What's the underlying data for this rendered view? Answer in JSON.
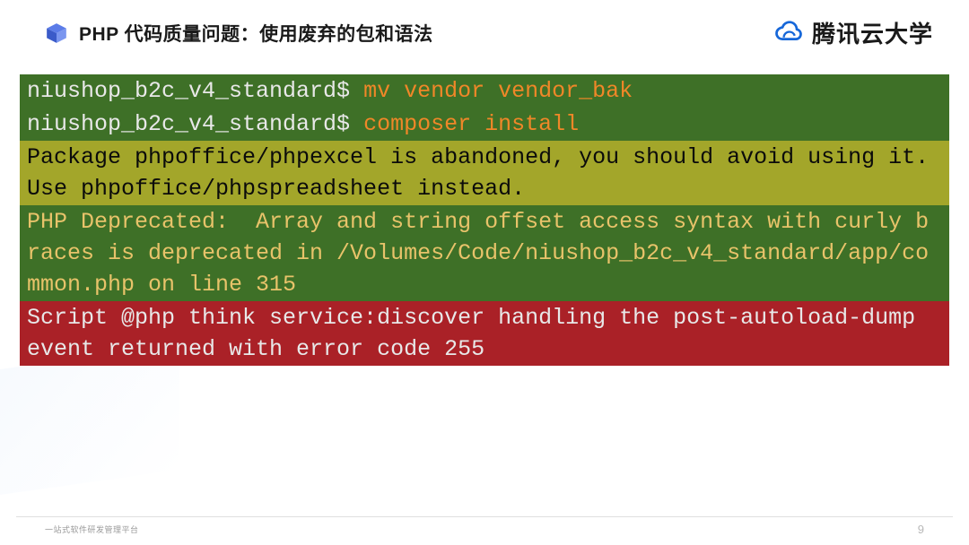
{
  "header": {
    "title": "PHP 代码质量问题：使用废弃的包和语法",
    "brand": "腾讯云大学"
  },
  "terminal": {
    "line1_prompt": "niushop_b2c_v4_standard$ ",
    "line1_cmd": "mv vendor vendor_bak",
    "line2_prompt": "niushop_b2c_v4_standard$ ",
    "line2_cmd": "composer install",
    "line3": "Package phpoffice/phpexcel is abandoned, you should avoid using it. Use phpoffice/phpspreadsheet instead.",
    "line4": "PHP Deprecated:  Array and string offset access syntax with curly braces is deprecated in /Volumes/Code/niushop_b2c_v4_standard/app/common.php on line 315",
    "line5": "Script @php think service:discover handling the post-autoload-dump event returned with error code 255"
  },
  "footer": {
    "left": "一站式软件研发管理平台",
    "page": "9"
  }
}
